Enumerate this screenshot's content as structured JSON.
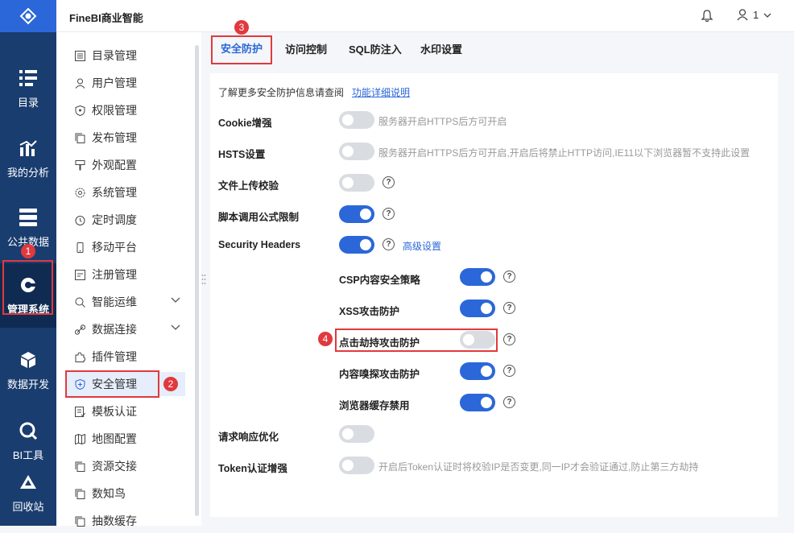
{
  "app": {
    "title": "FineBI商业智能",
    "user_name": "1"
  },
  "sidebar": {
    "items": [
      {
        "label": "目录",
        "icon": "catalog-icon"
      },
      {
        "label": "我的分析",
        "icon": "analysis-icon"
      },
      {
        "label": "公共数据",
        "icon": "database-icon"
      },
      {
        "label": "管理系统",
        "icon": "gear-icon"
      },
      {
        "label": "数据开发",
        "icon": "cube-icon"
      },
      {
        "label": "BI工具",
        "icon": "tool-icon"
      },
      {
        "label": "回收站",
        "icon": "recycle-icon"
      }
    ]
  },
  "menu": {
    "items": [
      {
        "label": "目录管理"
      },
      {
        "label": "用户管理"
      },
      {
        "label": "权限管理"
      },
      {
        "label": "发布管理"
      },
      {
        "label": "外观配置"
      },
      {
        "label": "系统管理"
      },
      {
        "label": "定时调度"
      },
      {
        "label": "移动平台"
      },
      {
        "label": "注册管理"
      },
      {
        "label": "智能运维"
      },
      {
        "label": "数据连接"
      },
      {
        "label": "插件管理"
      },
      {
        "label": "安全管理"
      },
      {
        "label": "模板认证"
      },
      {
        "label": "地图配置"
      },
      {
        "label": "资源交接"
      },
      {
        "label": "数知鸟"
      },
      {
        "label": "抽数缓存"
      }
    ]
  },
  "tabs": [
    {
      "label": "安全防护"
    },
    {
      "label": "访问控制"
    },
    {
      "label": "SQL防注入"
    },
    {
      "label": "水印设置"
    }
  ],
  "intro": {
    "text": "了解更多安全防护信息请查阅",
    "link": "功能详细说明"
  },
  "settings": {
    "cookie": {
      "label": "Cookie增强",
      "on": false,
      "hint": "服务器开启HTTPS后方可开启"
    },
    "hsts": {
      "label": "HSTS设置",
      "on": false,
      "hint": "服务器开启HTTPS后方可开启,开启后将禁止HTTP访问,IE11以下浏览器暂不支持此设置"
    },
    "upload": {
      "label": "文件上传校验",
      "on": false
    },
    "script": {
      "label": "脚本调用公式限制",
      "on": true
    },
    "security_headers": {
      "label": "Security Headers",
      "on": true,
      "link": "高级设置"
    },
    "csp": {
      "label": "CSP内容安全策略",
      "on": true
    },
    "xss": {
      "label": "XSS攻击防护",
      "on": true
    },
    "clickjack": {
      "label": "点击劫持攻击防护",
      "on": false
    },
    "sniff": {
      "label": "内容嗅探攻击防护",
      "on": true
    },
    "cache": {
      "label": "浏览器缓存禁用",
      "on": true
    },
    "response": {
      "label": "请求响应优化",
      "on": false
    },
    "token": {
      "label": "Token认证增强",
      "on": false,
      "hint": "开启后Token认证时将校验IP是否变更,同一IP才会验证通过,防止第三方劫持"
    }
  },
  "annotations": {
    "b1": "1",
    "b2": "2",
    "b3": "3",
    "b4": "4"
  },
  "colors": {
    "sidebar": "#1a3d6f",
    "accent": "#2b67d8",
    "marker": "#e0393e"
  }
}
